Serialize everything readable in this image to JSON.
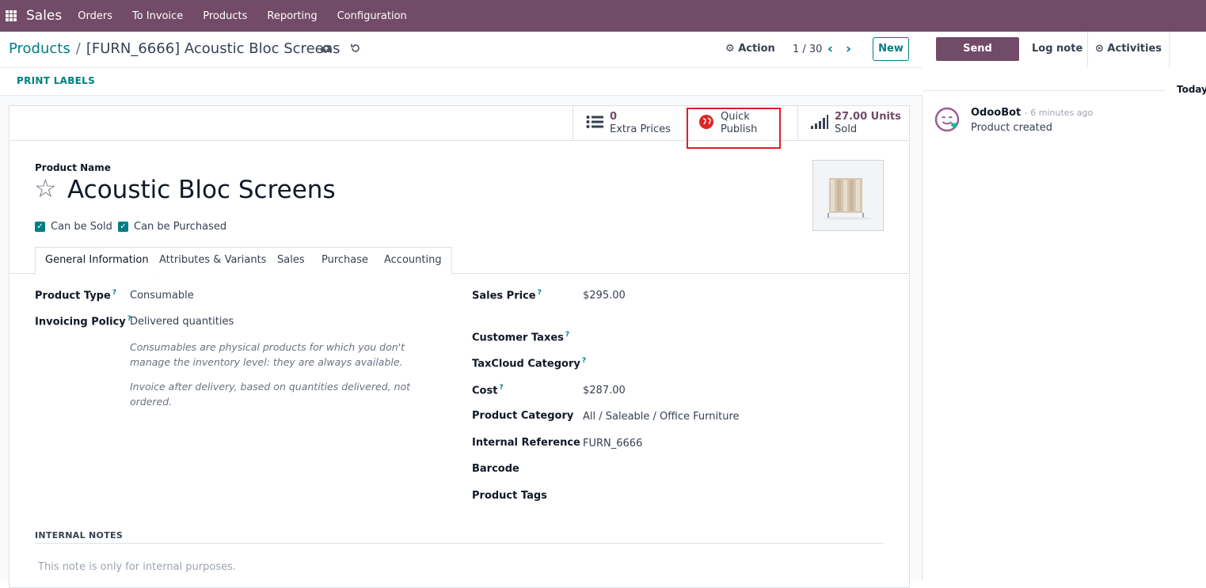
{
  "navbar": {
    "app_name": "Sales",
    "menu": [
      "Orders",
      "To Invoice",
      "Products",
      "Reporting",
      "Configuration"
    ],
    "bg_color": "#714B67"
  },
  "control_panel": {
    "breadcrumb_parent": "Products",
    "breadcrumb_current": "[FURN_6666] Acoustic Bloc Screens",
    "action_label": "Action",
    "pager": "1 / 30",
    "new_label": "New"
  },
  "statusbar": {
    "print_labels": "PRINT LABELS"
  },
  "smart_buttons": {
    "extra_prices_count": "0",
    "extra_prices_label": "Extra Prices",
    "publish_line1": "Quick",
    "publish_line2": "Publish",
    "sold_value": "27.00 Units",
    "sold_label": "Sold"
  },
  "product": {
    "name_label": "Product Name",
    "name": "Acoustic Bloc Screens",
    "can_be_sold": "Can be Sold",
    "can_be_purchased": "Can be Purchased"
  },
  "tabs": [
    "General Information",
    "Attributes & Variants",
    "Sales",
    "Purchase",
    "Accounting"
  ],
  "general": {
    "product_type_label": "Product Type",
    "product_type": "Consumable",
    "invoicing_policy_label": "Invoicing Policy",
    "invoicing_policy": "Delivered quantities",
    "help_consumable": "Consumables are physical products for which you don't manage the inventory level: they are always available.",
    "help_invoice": "Invoice after delivery, based on quantities delivered, not ordered.",
    "sales_price_label": "Sales Price",
    "sales_price": "$295.00",
    "customer_taxes_label": "Customer Taxes",
    "taxcloud_label": "TaxCloud Category",
    "cost_label": "Cost",
    "cost": "$287.00",
    "category_label": "Product Category",
    "category": "All / Saleable / Office Furniture",
    "internal_ref_label": "Internal Reference",
    "internal_ref": "FURN_6666",
    "barcode_label": "Barcode",
    "tags_label": "Product Tags",
    "help_marker": "?"
  },
  "notes": {
    "heading": "INTERNAL NOTES",
    "placeholder": "This note is only for internal purposes."
  },
  "chatter": {
    "send_message": "Send message",
    "log_note": "Log note",
    "activities": "Activities",
    "today": "Today",
    "author": "OdooBot",
    "time": "- 6 minutes ago",
    "message": "Product created"
  }
}
